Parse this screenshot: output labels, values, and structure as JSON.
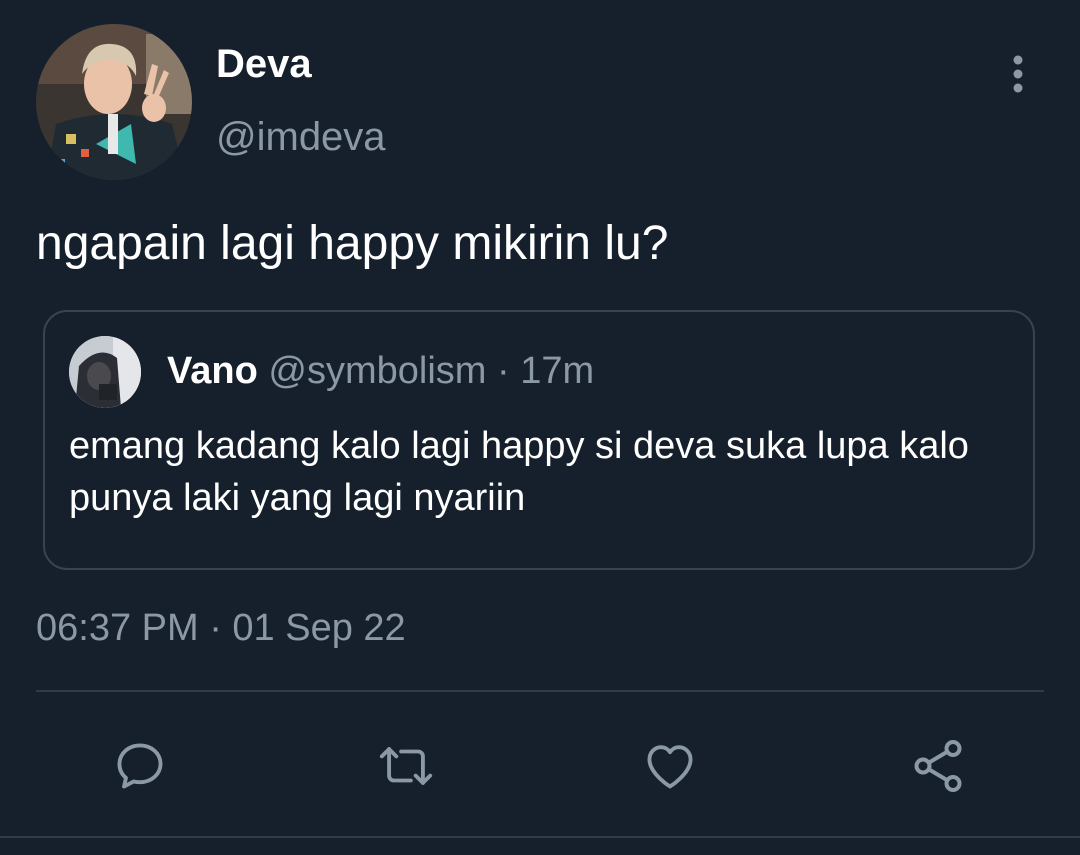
{
  "tweet": {
    "author": {
      "display_name": "Deva",
      "handle": "@imdeva"
    },
    "text": "ngapain lagi happy mikirin lu?",
    "timestamp": "06:37 PM · 01 Sep 22"
  },
  "quote": {
    "display_name": "Vano",
    "handle": "@symbolism",
    "separator": "·",
    "time": "17m",
    "text": "emang kadang kalo lagi happy si deva suka lupa kalo punya laki yang lagi nyariin"
  },
  "actions": [
    {
      "icon": "reply-icon"
    },
    {
      "icon": "retweet-icon"
    },
    {
      "icon": "like-icon"
    },
    {
      "icon": "share-icon"
    }
  ],
  "colors": {
    "background": "#16202c",
    "primary_text": "#ffffff",
    "secondary_text": "#8b98a5",
    "border": "#38444d"
  }
}
